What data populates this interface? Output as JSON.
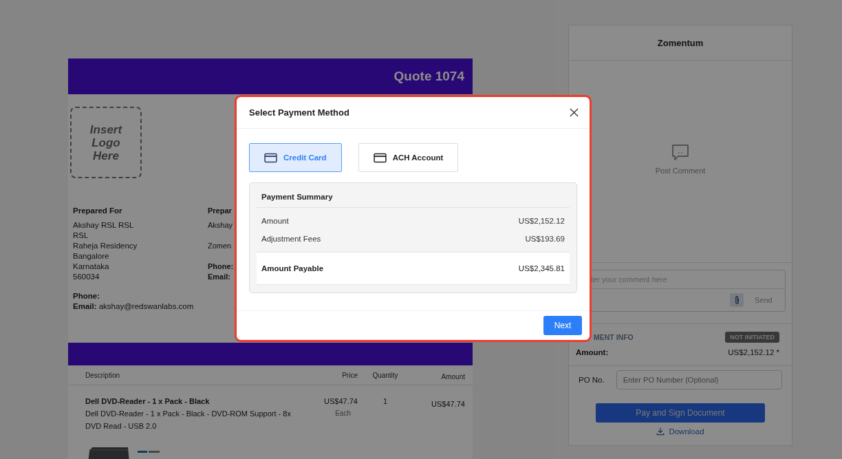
{
  "quote": {
    "title": "Quote 1074",
    "logo_placeholder": "Insert Logo Here",
    "prepared_for": {
      "heading": "Prepared For",
      "lines": [
        "Akshay RSL RSL",
        "RSL",
        "Raheja Residency",
        "Bangalore",
        "Karnataka",
        "560034"
      ],
      "phone_label": "Phone:",
      "email_label": "Email:",
      "email": "akshay@redswanlabs.com"
    },
    "prepared_by": {
      "heading": "Prepar",
      "name": "Akshay",
      "company": "Zomen",
      "phone_label": "Phone:",
      "email_label": "Email:"
    },
    "table": {
      "columns": [
        "Description",
        "Price",
        "Quantity",
        "Amount"
      ],
      "rows": [
        {
          "title": "Dell DVD-Reader - 1 x Pack - Black",
          "description": "Dell DVD-Reader - 1 x Pack - Black - DVD-ROM Support - 8x DVD Read - USB 2.0",
          "price": "US$47.74",
          "unit": "Each",
          "quantity": "1",
          "amount": "US$47.74"
        }
      ]
    }
  },
  "side_panel": {
    "title": "Zomentum",
    "empty_text": "Post Comment",
    "comment_placeholder": "ter your comment here",
    "send": "Send",
    "payment_info": {
      "heading": "MENT INFO",
      "status": "NOT INITIATED",
      "amount_label": "Amount:",
      "amount": "US$2,152.12 *"
    },
    "po": {
      "label": "PO No.",
      "placeholder": "Enter PO Number (Optional)"
    },
    "pay_button": "Pay and Sign Document",
    "download": "Download"
  },
  "modal": {
    "title": "Select Payment Method",
    "methods": [
      {
        "label": "Credit Card",
        "selected": true
      },
      {
        "label": "ACH Account",
        "selected": false
      }
    ],
    "summary": {
      "heading": "Payment Summary",
      "rows": [
        {
          "label": "Amount",
          "value": "US$2,152.12"
        },
        {
          "label": "Adjustment Fees",
          "value": "US$193.69"
        }
      ],
      "total": {
        "label": "Amount Payable",
        "value": "US$2,345.81"
      }
    },
    "next": "Next"
  }
}
